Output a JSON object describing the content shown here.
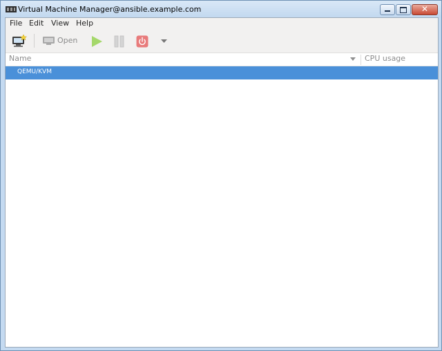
{
  "window": {
    "title": "Virtual Machine Manager@ansible.example.com"
  },
  "menubar": {
    "items": [
      {
        "label": "File"
      },
      {
        "label": "Edit"
      },
      {
        "label": "View"
      },
      {
        "label": "Help"
      }
    ]
  },
  "toolbar": {
    "open_label": "Open"
  },
  "columns": {
    "name": "Name",
    "cpu": "CPU usage"
  },
  "connections": [
    {
      "label": "QEMU/KVM",
      "selected": true
    }
  ],
  "colors": {
    "selection": "#4a90d9",
    "run": "#a5d86b",
    "shutdown": "#e87b7b"
  }
}
